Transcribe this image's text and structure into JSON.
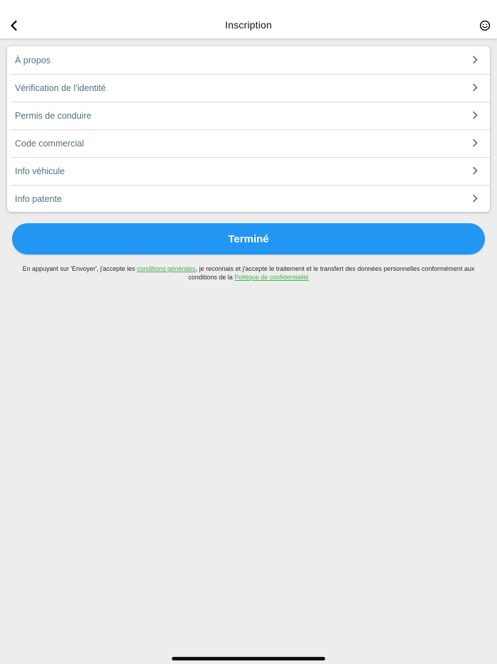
{
  "header": {
    "title": "Inscription",
    "back_icon": "chevron-left-icon",
    "support_icon": "smiley-face-icon"
  },
  "menu": {
    "items": [
      {
        "label": "À propos"
      },
      {
        "label": "Vérification de l'identité"
      },
      {
        "label": "Permis de conduire"
      },
      {
        "label": "Code commercial"
      },
      {
        "label": "Info véhicule"
      },
      {
        "label": "Info patente"
      }
    ],
    "chevron_icon": "chevron-right-icon"
  },
  "done_button": {
    "label": "Terminé"
  },
  "legal": {
    "prefix": "En appuyant sur 'Envoyer', j'accepte les ",
    "terms_link": "conditions générales",
    "middle": ", je reconnais et j'accepte le traitement et le transfert des données personnelles conformément aux conditions de la ",
    "privacy_link": "Politique de confidentialité"
  },
  "colors": {
    "accent": "#2196f3",
    "link": "#4caf50",
    "row_text": "#55707f",
    "background": "#ededed"
  }
}
